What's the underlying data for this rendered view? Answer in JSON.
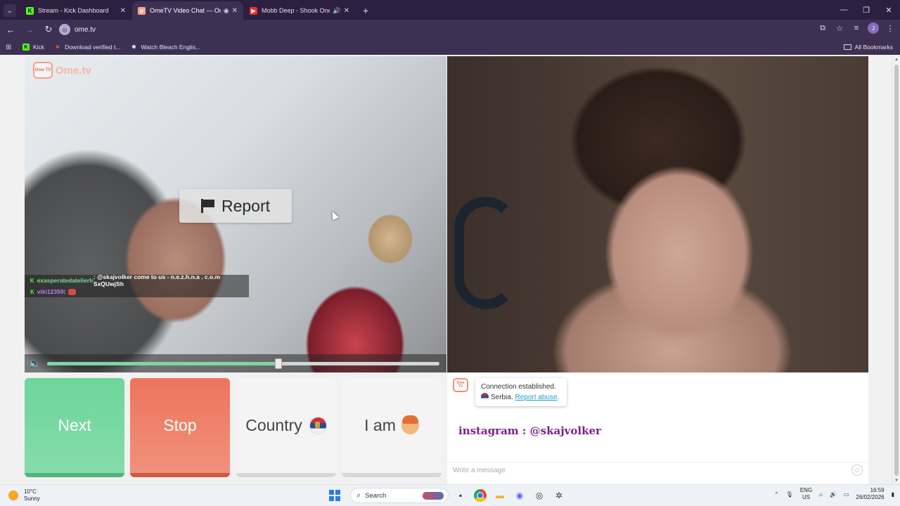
{
  "browser": {
    "tabs": [
      {
        "title": "Stream - Kick Dashboard",
        "favicon": "kick-icon",
        "active": false
      },
      {
        "title": "OmeTV Video Chat — Ome",
        "favicon": "ometv-icon",
        "active": true,
        "recording": true
      },
      {
        "title": "Mobb Deep - Shook Ones,",
        "favicon": "youtube-icon",
        "active": false,
        "audio": true
      }
    ],
    "url": "ome.tv",
    "bookmarks": [
      {
        "label": "Kick",
        "icon": "kick-icon"
      },
      {
        "label": "Download verified t...",
        "icon": "x-icon"
      },
      {
        "label": "Watch Bleach Englis...",
        "icon": "anime-icon"
      }
    ],
    "all_bookmarks_label": "All Bookmarks",
    "profile_initial": "J"
  },
  "page": {
    "logo_text": "Ome.tv",
    "logo_box_text": "Ome TV",
    "report_label": "Report",
    "stream_chat": [
      {
        "user": "exasperatedatelierlr",
        "message": ": @skajvolker come to us - n.e.z.h.n.a . c.o.m SxQUwjSh"
      },
      {
        "user": "viki12359",
        "message": ":"
      }
    ],
    "volume_level": 0.59,
    "buttons": {
      "next": "Next",
      "stop": "Stop",
      "country": "Country",
      "iam": "I am"
    },
    "chat": {
      "system_line1": "Connection established.",
      "country": "Serbia.",
      "report_abuse": "Report abuse",
      "report_suffix": ".",
      "user_message": "instagram : @skajvolker",
      "input_placeholder": "Write a message"
    }
  },
  "taskbar": {
    "temperature": "10°C",
    "condition": "Sunny",
    "search_label": "Search",
    "lang_line1": "ENG",
    "lang_line2": "US",
    "time": "16:59",
    "date": "26/02/2026"
  }
}
